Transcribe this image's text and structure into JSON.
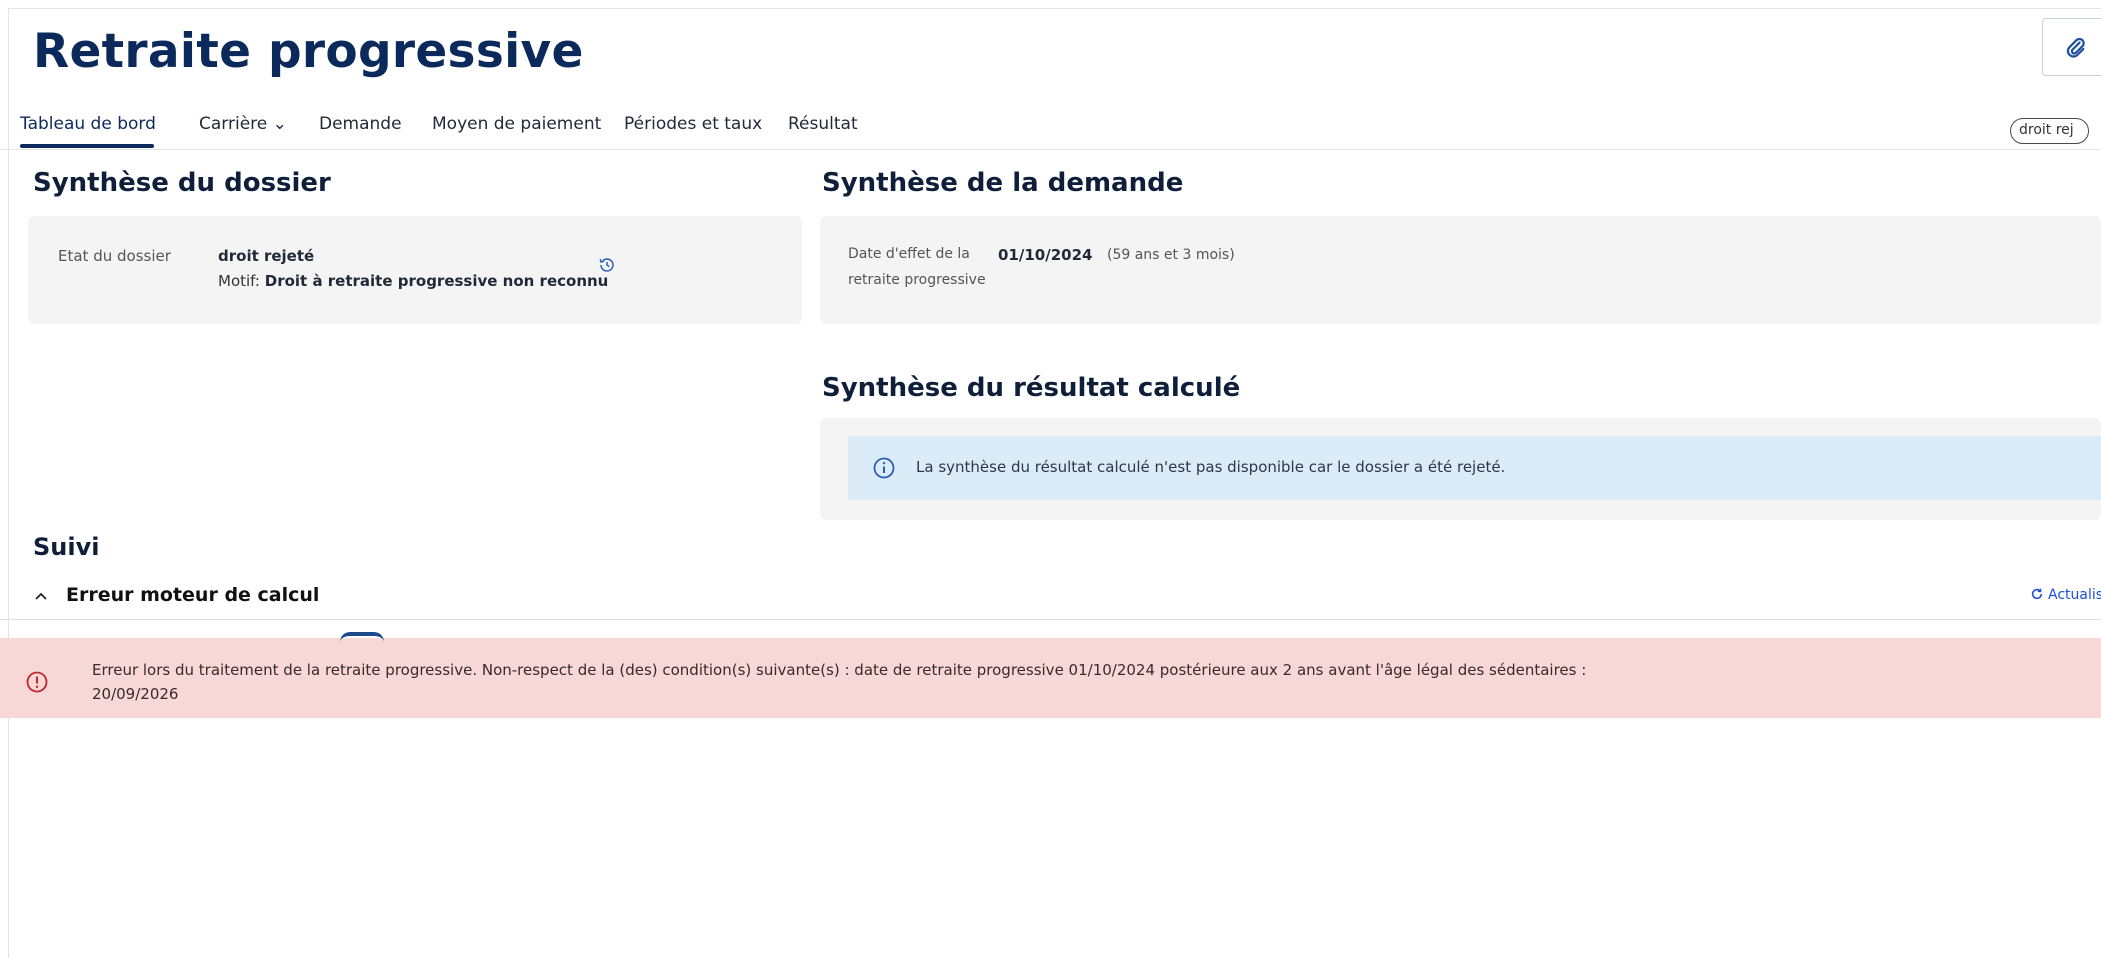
{
  "page": {
    "title": "Retraite progressive"
  },
  "tabs": [
    {
      "label": "Tableau de bord"
    },
    {
      "label": "Carrière ⌄"
    },
    {
      "label": "Demande"
    },
    {
      "label": "Moyen de paiement"
    },
    {
      "label": "Périodes et taux"
    },
    {
      "label": "Résultat"
    }
  ],
  "status_chip": "droit rej",
  "dossier": {
    "section_title": "Synthèse du dossier",
    "label": "Etat du dossier",
    "state": "droit rejeté",
    "motif_label": "Motif: ",
    "motif_value": "Droit à retraite progressive non reconnu"
  },
  "demande": {
    "section_title": "Synthèse de la demande",
    "label_line1": "Date d'effet de la",
    "label_line2": "retraite progressive",
    "date": "01/10/2024",
    "age": "(59 ans et 3 mois)"
  },
  "resultat": {
    "section_title": "Synthèse du résultat calculé",
    "info_text": "La synthèse du résultat calculé n'est pas disponible car le dossier a été rejeté."
  },
  "suivi": {
    "section_title": "Suivi",
    "collapse_title": "Erreur moteur de calcul",
    "refresh_label": "Actualis",
    "error_line1": "Erreur lors du traitement de la retraite progressive. Non-respect de la (des) condition(s) suivante(s) : date de retraite progressive 01/10/2024 postérieure aux 2 ans avant l'âge légal des sédentaires :",
    "error_line2": "20/09/2026"
  },
  "colors": {
    "primary": "#0b2a5b",
    "info_bg": "#dcebf8",
    "error_bg": "#f8d7d7",
    "card_bg": "#f4f4f4"
  }
}
